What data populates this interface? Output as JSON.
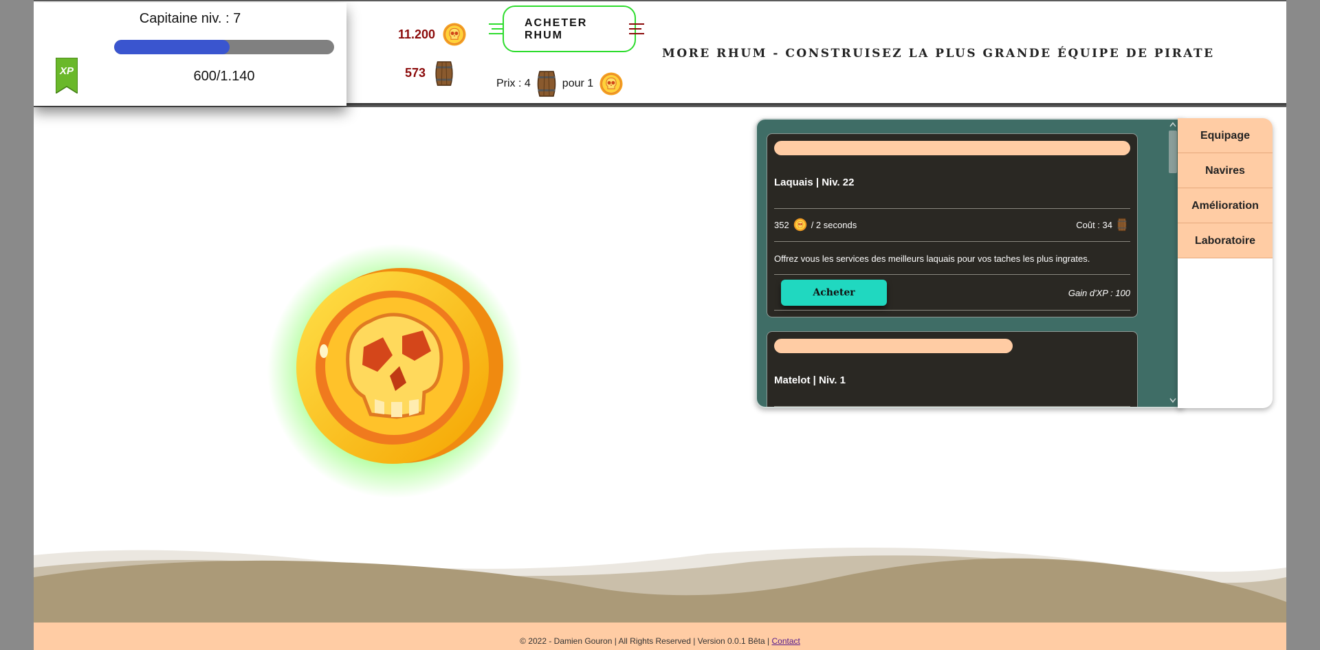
{
  "header": {
    "level_text": "Capitaine niv. : 7",
    "xp_count": "600/1.140",
    "xp_progress_fraction": 0.526,
    "xp_badge_text": "XP",
    "gold_amount": "11.200",
    "rum_amount": "573",
    "buy_rum_label": "ACHETER RHUM",
    "price_prefix": "Prix : 4",
    "price_middle": "pour 1",
    "tagline": "MORE RHUM - CONSTRUISEZ LA PLUS GRANDE ÉQUIPE DE PIRATE"
  },
  "shop": {
    "cards": [
      {
        "progress_fraction": 1.0,
        "title": "Laquais | Niv. 22",
        "rate_amount": "352",
        "rate_suffix": "/ 2 seconds",
        "cost_text": "Coût : 34",
        "description": "Offrez vous les services des meilleurs laquais pour vos taches les plus ingrates.",
        "buy_label": "Acheter",
        "xp_gain": "Gain d'XP : 100"
      },
      {
        "progress_fraction": 0.67,
        "title": "Matelot | Niv. 1"
      }
    ]
  },
  "tabs": [
    "Equipage",
    "Navires",
    "Amélioration",
    "Laboratoire"
  ],
  "footer": {
    "text": "© 2022 - Damien Gouron | All Rights Reserved | Version 0.0.1 Bêta |",
    "link": "Contact"
  },
  "icons": {
    "coin": "skull-coin-icon",
    "rum": "barrel-icon",
    "xp": "xp-badge-icon"
  },
  "colors": {
    "gold_text": "#8b0a0a",
    "xp_fill": "#3a55cf",
    "buy_rum_border": "#2ddc2d",
    "tab_bg": "#ffcca4",
    "buy_button": "#20d8c0",
    "panel_bg": "#3f6d66",
    "card_bg": "#2a2823"
  }
}
